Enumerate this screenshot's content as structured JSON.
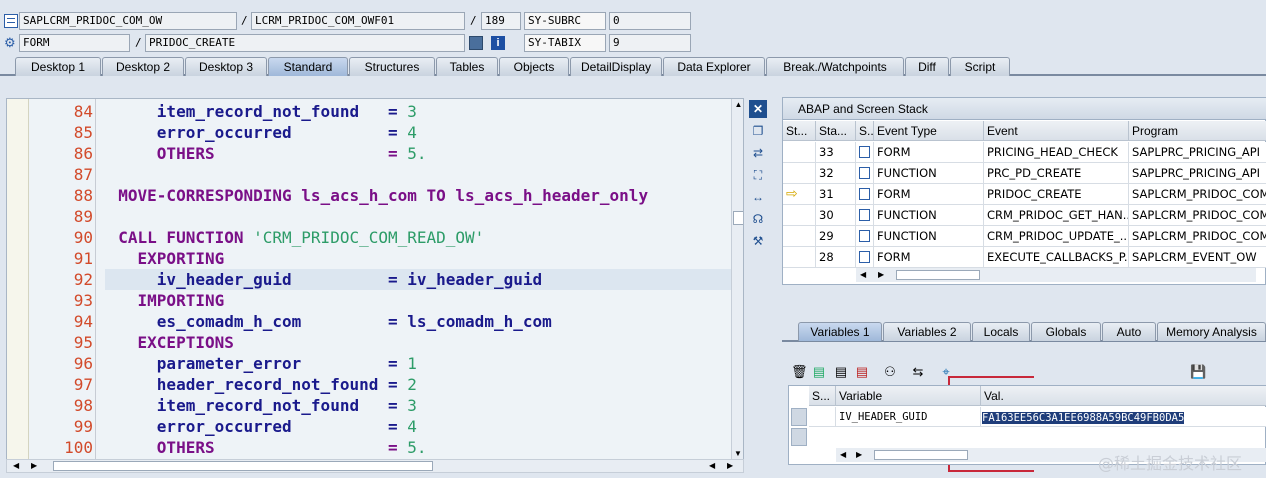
{
  "header": {
    "program": "SAPLCRM_PRIDOC_COM_OW",
    "include": "LCRM_PRIDOC_COM_OWF01",
    "line": "189",
    "sysvar1_name": "SY-SUBRC",
    "sysvar1_value": "0",
    "event_type": "FORM",
    "event_name": "PRIDOC_CREATE",
    "sysvar2_name": "SY-TABIX",
    "sysvar2_value": "9",
    "slash": "/"
  },
  "tabs": [
    "Desktop 1",
    "Desktop 2",
    "Desktop 3",
    "Standard",
    "Structures",
    "Tables",
    "Objects",
    "DetailDisplay",
    "Data Explorer",
    "Break./Watchpoints",
    "Diff",
    "Script"
  ],
  "active_tab": "Standard",
  "code": {
    "lines": [
      {
        "n": "84",
        "t": "      item_record_not_found   = ",
        "v": "3"
      },
      {
        "n": "85",
        "t": "      error_occurred          = ",
        "v": "4"
      },
      {
        "n": "86",
        "t": "      OTHERS                  = ",
        "v": "5."
      },
      {
        "n": "87",
        "t": "",
        "v": ""
      },
      {
        "n": "88",
        "t": "  MOVE-CORRESPONDING ls_acs_h_com TO ls_acs_h_header_only",
        "v": ""
      },
      {
        "n": "89",
        "t": "",
        "v": ""
      },
      {
        "n": "90",
        "t": "  CALL FUNCTION ",
        "v": "'CRM_PRIDOC_COM_READ_OW'"
      },
      {
        "n": "91",
        "t": "    EXPORTING",
        "v": ""
      },
      {
        "n": "92",
        "t": "      iv_header_guid          = iv_header_guid",
        "v": ""
      },
      {
        "n": "93",
        "t": "    IMPORTING",
        "v": ""
      },
      {
        "n": "94",
        "t": "      es_comadm_h_com         = ls_comadm_h_com",
        "v": ""
      },
      {
        "n": "95",
        "t": "    EXCEPTIONS",
        "v": ""
      },
      {
        "n": "96",
        "t": "      parameter_error         = ",
        "v": "1"
      },
      {
        "n": "97",
        "t": "      header_record_not_found = ",
        "v": "2"
      },
      {
        "n": "98",
        "t": "      item_record_not_found   = ",
        "v": "3"
      },
      {
        "n": "99",
        "t": "      error_occurred          = ",
        "v": "4"
      },
      {
        "n": "100",
        "t": "      OTHERS                  = ",
        "v": "5."
      }
    ]
  },
  "stack": {
    "title": "ABAP and Screen Stack",
    "columns": [
      "St...",
      "Sta...",
      "S...",
      "Event Type",
      "Event",
      "Program"
    ],
    "rows": [
      {
        "level": "33",
        "type": "FORM",
        "event": "PRICING_HEAD_CHECK",
        "program": "SAPLPRC_PRICING_API"
      },
      {
        "level": "32",
        "type": "FUNCTION",
        "event": "PRC_PD_CREATE",
        "program": "SAPLPRC_PRICING_API"
      },
      {
        "level": "31",
        "type": "FORM",
        "event": "PRIDOC_CREATE",
        "program": "SAPLCRM_PRIDOC_COM..."
      },
      {
        "level": "30",
        "type": "FUNCTION",
        "event": "CRM_PRIDOC_GET_HAN...",
        "program": "SAPLCRM_PRIDOC_COM..."
      },
      {
        "level": "29",
        "type": "FUNCTION",
        "event": "CRM_PRIDOC_UPDATE_...",
        "program": "SAPLCRM_PRIDOC_COM..."
      },
      {
        "level": "28",
        "type": "FORM",
        "event": "EXECUTE_CALLBACKS_P...",
        "program": "SAPLCRM_EVENT_OW"
      }
    ]
  },
  "var_tabs": [
    "Variables 1",
    "Variables 2",
    "Locals",
    "Globals",
    "Auto",
    "Memory Analysis"
  ],
  "variables": {
    "columns": [
      "S...",
      "Variable",
      "Val."
    ],
    "rows": [
      {
        "name": "IV_HEADER_GUID",
        "value": "FA163EE56C3A1EE6988A59BC49FB0DA5"
      }
    ]
  },
  "watermark": "@稀土掘金技术社区",
  "colors": {
    "line_number": "#d24a2a",
    "keyword": "#7a0f87",
    "literal": "#2d9c68",
    "highlight": "#dce6f0",
    "selection": "#1f3d7a",
    "red_annotation": "#c8283a"
  }
}
